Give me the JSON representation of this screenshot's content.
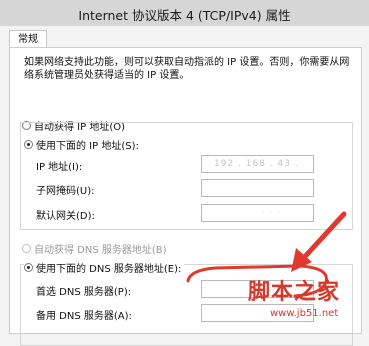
{
  "window": {
    "title": "Internet 协议版本 4 (TCP/IPv4) 属性"
  },
  "tabs": [
    {
      "label": "常规"
    }
  ],
  "description": "如果网络支持此功能，则可以获取自动指派的 IP 设置。否则，你需要从网络系统管理员处获得适当的 IP 设置。",
  "ip_section": {
    "auto_label": "自动获得 IP 地址(O)",
    "manual_label": "使用下面的 IP 地址(S):",
    "manual_selected": true,
    "fields": [
      {
        "label": "IP 地址(I):",
        "value": "192 . 168 . 43 ."
      },
      {
        "label": "子网掩码(U):",
        "value": ""
      },
      {
        "label": "默认网关(D):",
        "value": "·  ·  ·"
      }
    ]
  },
  "dns_section": {
    "auto_label": "自动获得 DNS 服务器地址(B)",
    "manual_label": "使用下面的 DNS 服务器地址(E):",
    "manual_selected": true,
    "fields": [
      {
        "label": "首选 DNS 服务器(P):",
        "value": ""
      },
      {
        "label": "备用 DNS 服务器(A):",
        "value": ""
      }
    ]
  },
  "annotation": {
    "color": "#e03a2f",
    "icon": "red-arrow"
  },
  "watermark": {
    "text": "脚本之家",
    "url": "www.jb51.net"
  }
}
